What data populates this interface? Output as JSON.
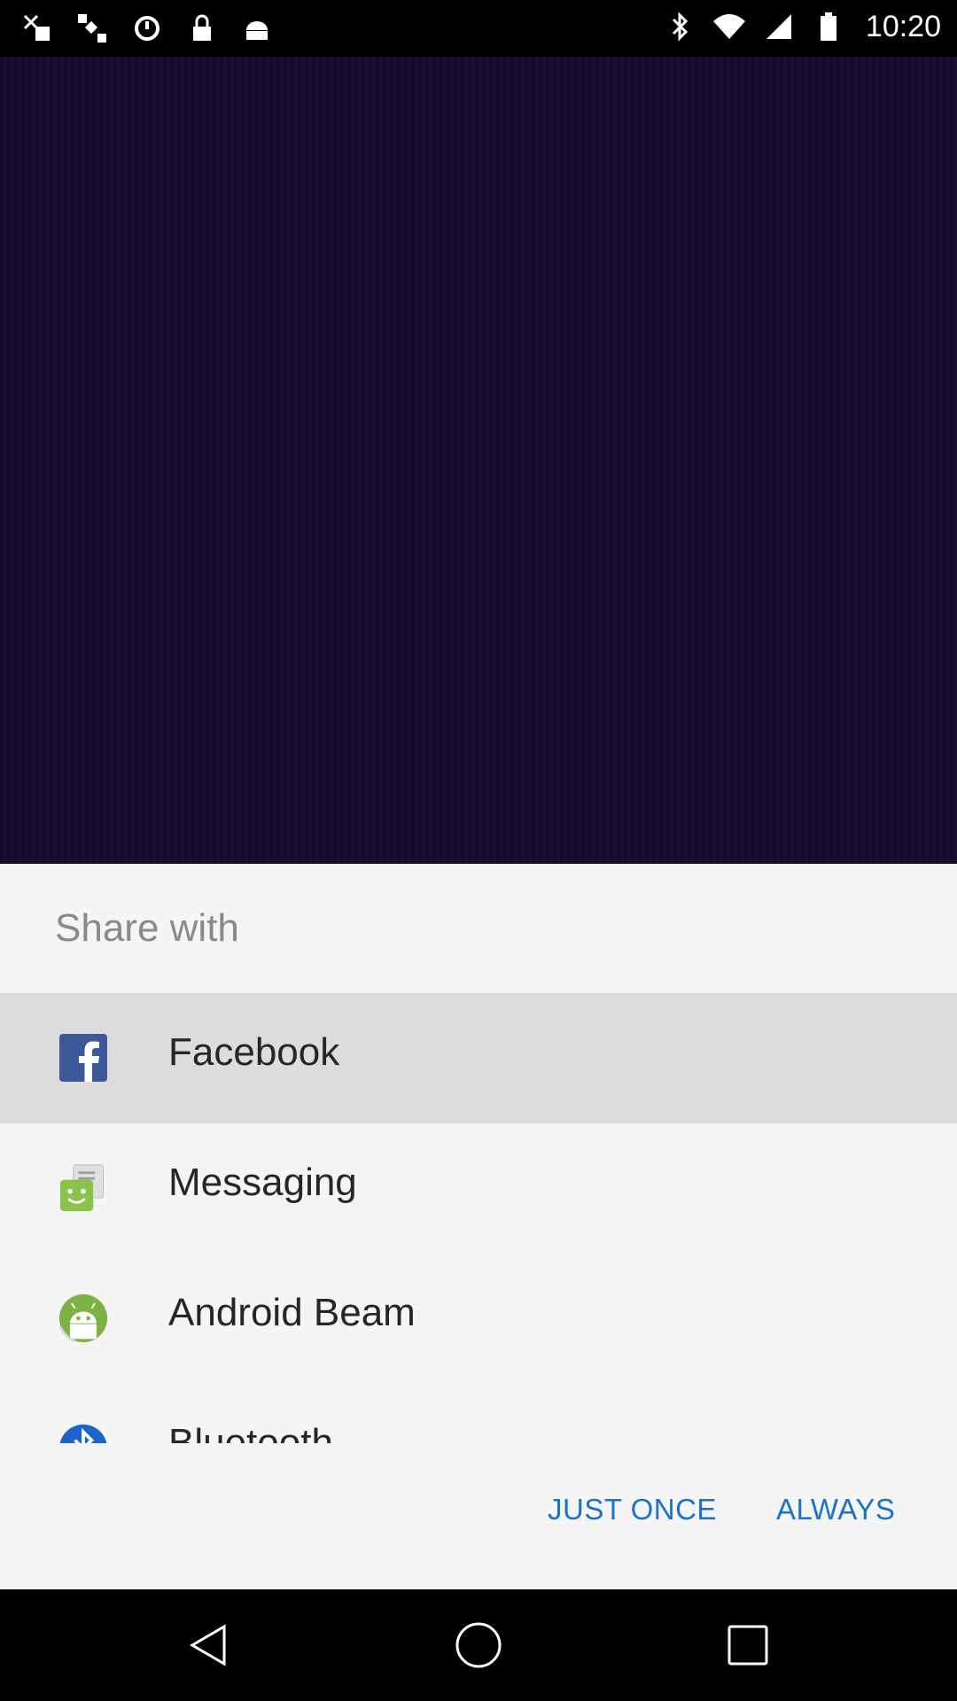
{
  "status_bar": {
    "time": "10:20",
    "left_icons": [
      "fake-gps-icon",
      "satellite-icon",
      "sync-icon",
      "lock-icon",
      "android-icon"
    ],
    "right_icons": [
      "bluetooth-icon",
      "wifi-icon",
      "signal-icon",
      "battery-icon"
    ]
  },
  "share_sheet": {
    "title": "Share with",
    "apps": [
      {
        "label": "Facebook",
        "icon": "facebook-icon",
        "selected": true
      },
      {
        "label": "Messaging",
        "icon": "messaging-icon",
        "selected": false
      },
      {
        "label": "Android Beam",
        "icon": "android-beam-icon",
        "selected": false
      },
      {
        "label": "Bluetooth",
        "icon": "bluetooth-share-icon",
        "selected": false
      }
    ],
    "buttons": {
      "just_once": "JUST ONCE",
      "always": "ALWAYS"
    },
    "accent_color": "#1a73c9"
  },
  "nav_bar": {
    "icons": [
      "back-icon",
      "home-icon",
      "recents-icon"
    ]
  }
}
